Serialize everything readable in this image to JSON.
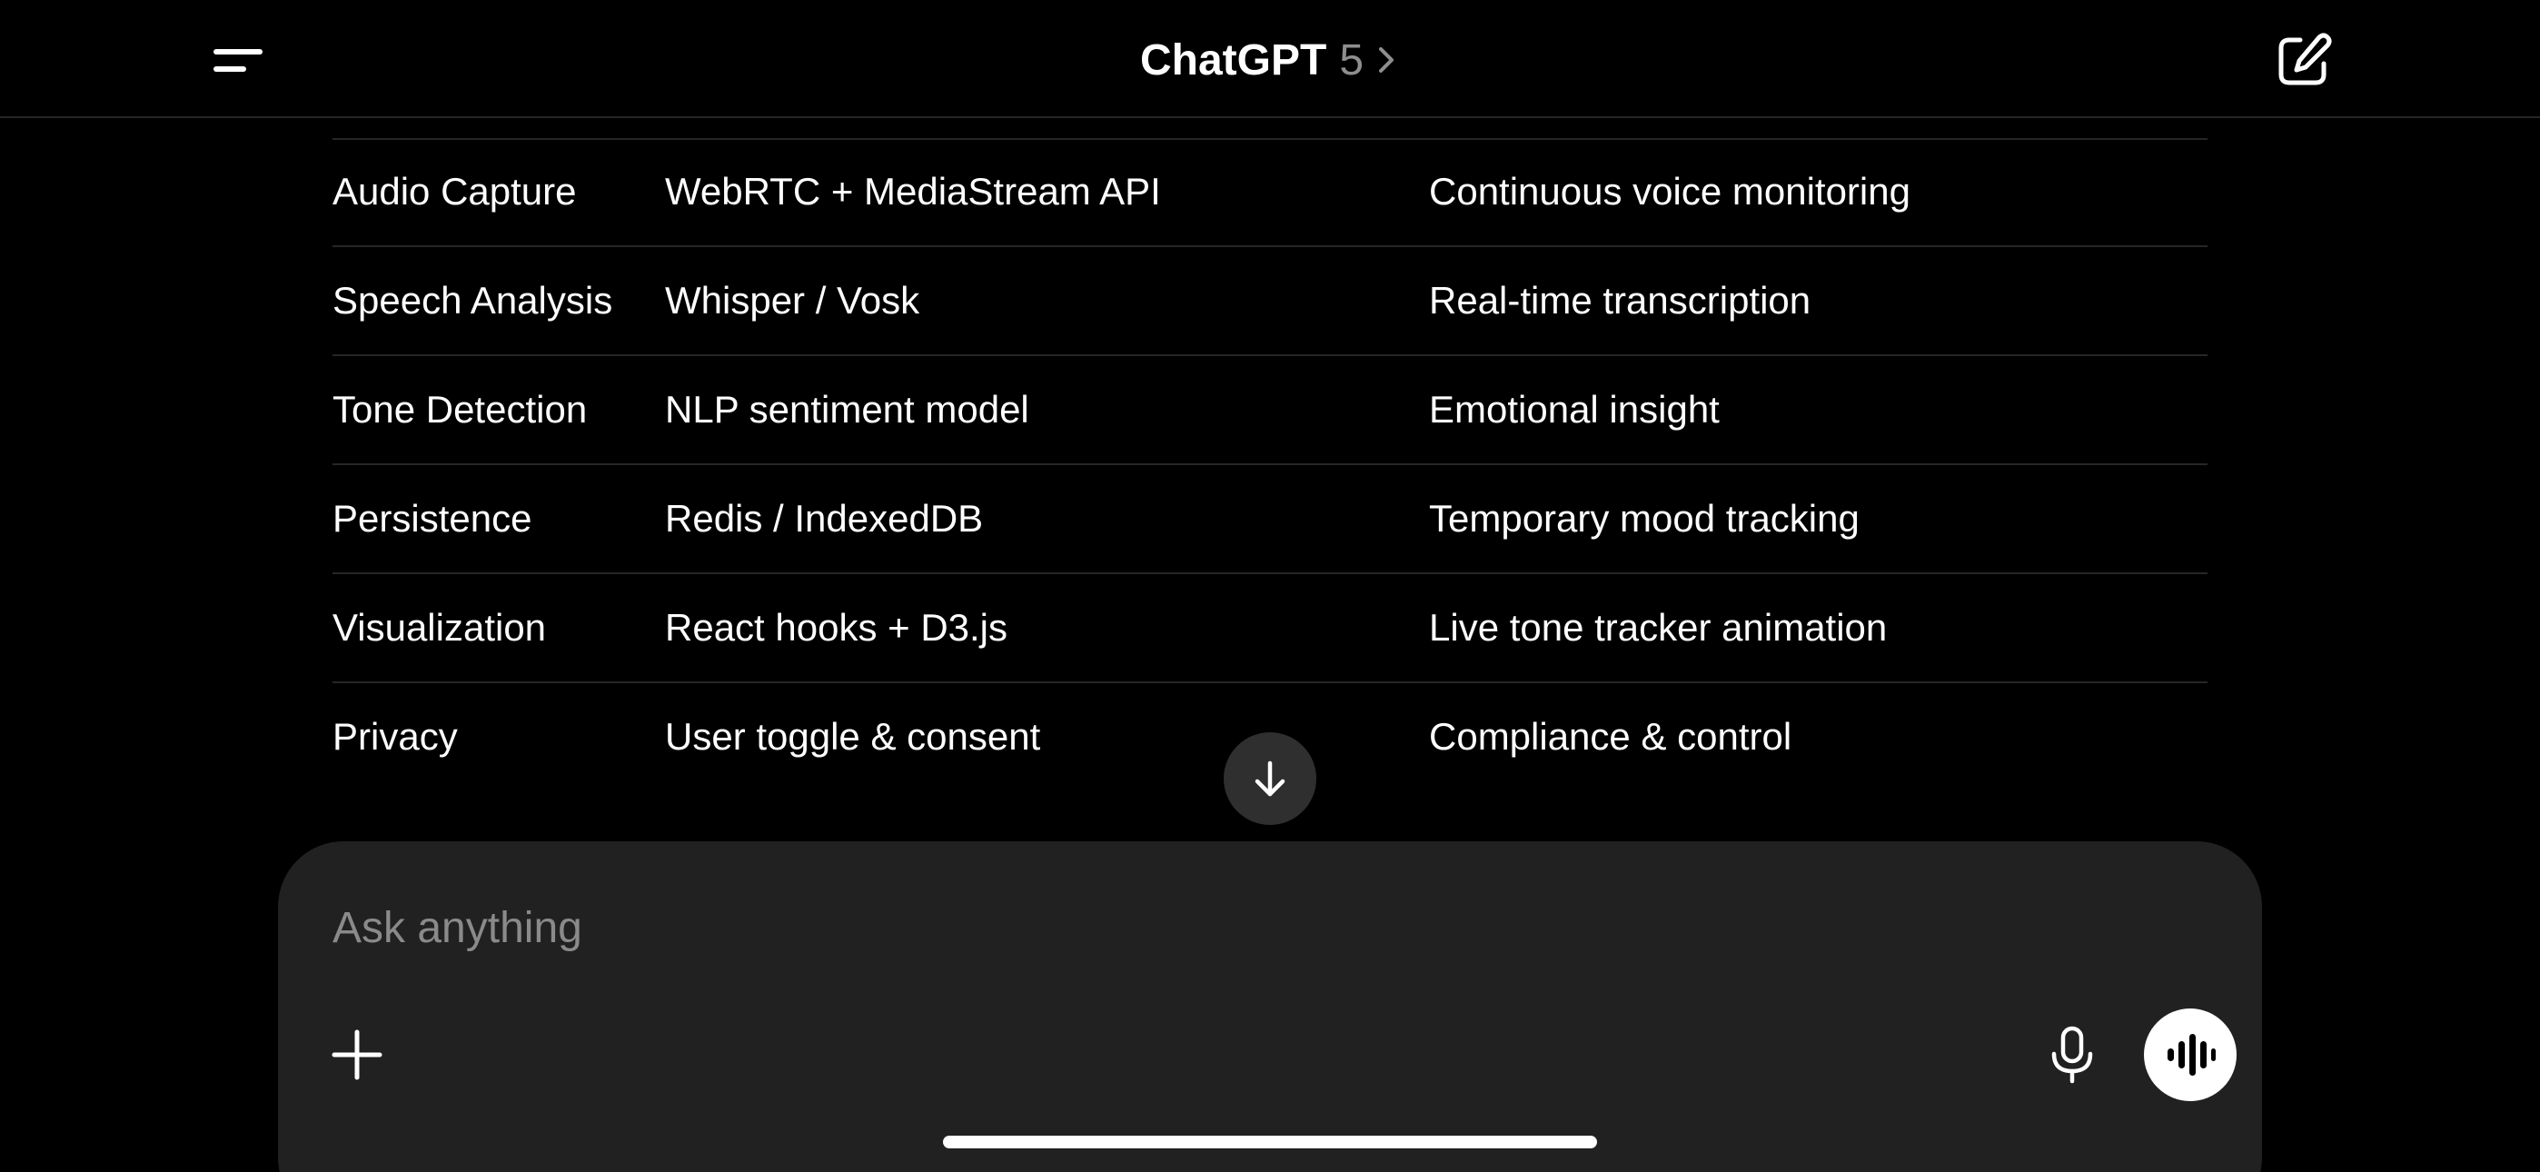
{
  "app": {
    "title": "ChatGPT",
    "model": "5"
  },
  "header": {
    "menu_icon": "hamburger-menu-icon",
    "chevron_icon": "chevron-right-icon",
    "new_chat_icon": "compose-icon"
  },
  "table": {
    "rows": [
      [
        "Audio Capture",
        "WebRTC + MediaStream API",
        "Continuous voice monitoring"
      ],
      [
        "Speech Analysis",
        "Whisper / Vosk",
        "Real-time transcription"
      ],
      [
        "Tone Detection",
        "NLP sentiment model",
        "Emotional insight"
      ],
      [
        "Persistence",
        "Redis / IndexedDB",
        "Temporary mood tracking"
      ],
      [
        "Visualization",
        "React hooks + D3.js",
        "Live tone tracker animation"
      ],
      [
        "Privacy",
        "User toggle & consent",
        "Compliance & control"
      ]
    ]
  },
  "scroll": {
    "icon": "arrow-down-icon"
  },
  "composer": {
    "placeholder": "Ask anything",
    "value": "",
    "plus_icon": "plus-icon",
    "mic_icon": "microphone-icon",
    "voice_icon": "voice-mode-waveform-icon"
  },
  "colors": {
    "background": "#000000",
    "composer": "#212121",
    "divider": "#262626",
    "muted_text": "#8e8e8e",
    "text": "#ffffff"
  }
}
